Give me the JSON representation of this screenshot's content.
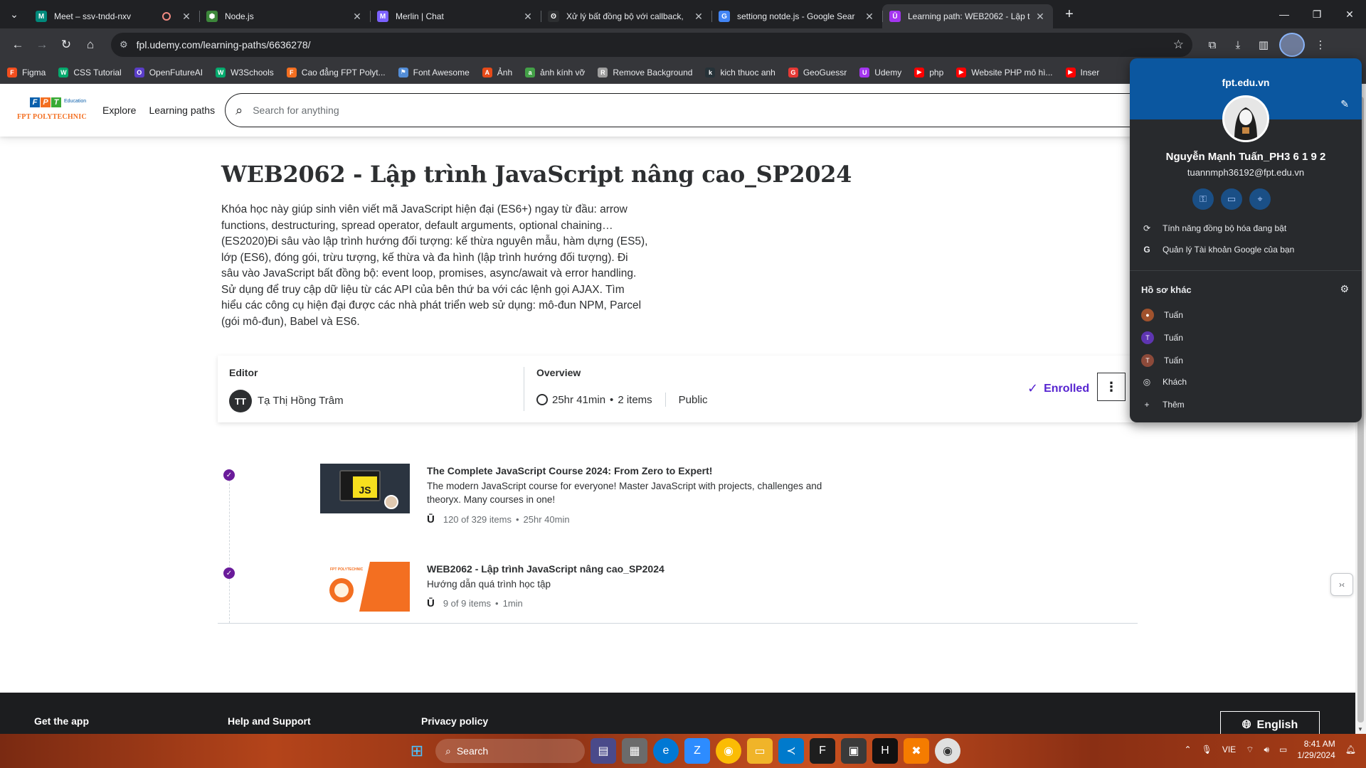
{
  "browser": {
    "tabs": [
      {
        "title": "Meet – ssv-tndd-nxv",
        "favicon_color": "#00897b",
        "favicon_glyph": "M",
        "recording": true
      },
      {
        "title": "Node.js",
        "favicon_color": "#3c873a",
        "favicon_glyph": "⬢",
        "recording": false
      },
      {
        "title": "Merlin | Chat",
        "favicon_color": "#7b61ff",
        "favicon_glyph": "M",
        "recording": false
      },
      {
        "title": "Xử lý bất đồng bộ với callback,",
        "favicon_color": "#2d2f31",
        "favicon_glyph": "ʘ",
        "recording": false
      },
      {
        "title": "settiong notde.js - Google Sear",
        "favicon_color": "#4285f4",
        "favicon_glyph": "G",
        "recording": false
      },
      {
        "title": "Learning path: WEB2062 - Lập t",
        "favicon_color": "#a435f0",
        "favicon_glyph": "Ū",
        "recording": false,
        "active": true
      }
    ],
    "url": "fpl.udemy.com/learning-paths/6636278/",
    "bookmarks": [
      {
        "label": "Figma",
        "color": "#f24e1e",
        "glyph": "F"
      },
      {
        "label": "CSS Tutorial",
        "color": "#04aa6d",
        "glyph": "W"
      },
      {
        "label": "OpenFutureAI",
        "color": "#5a3ec8",
        "glyph": "O"
      },
      {
        "label": "W3Schools",
        "color": "#04aa6d",
        "glyph": "W"
      },
      {
        "label": "Cao đẳng FPT Polyt...",
        "color": "#f36f21",
        "glyph": "F"
      },
      {
        "label": "Font Awesome",
        "color": "#538dd7",
        "glyph": "⚑"
      },
      {
        "label": "Ảnh",
        "color": "#e64a19",
        "glyph": "A"
      },
      {
        "label": "ảnh kính vỡ",
        "color": "#43a047",
        "glyph": "a"
      },
      {
        "label": "Remove Background",
        "color": "#9e9e9e",
        "glyph": "R"
      },
      {
        "label": "kich thuoc anh",
        "color": "#263238",
        "glyph": "k"
      },
      {
        "label": "GeoGuessr",
        "color": "#e53935",
        "glyph": "G"
      },
      {
        "label": "Udemy",
        "color": "#a435f0",
        "glyph": "U"
      },
      {
        "label": "php",
        "color": "#ff0000",
        "glyph": "▶"
      },
      {
        "label": "Website PHP mô hì...",
        "color": "#ff0000",
        "glyph": "▶"
      },
      {
        "label": "Inser",
        "color": "#ff0000",
        "glyph": "▶"
      }
    ]
  },
  "header": {
    "logo_brand": "FPT POLYTECHNIC",
    "logo_sub": "Education",
    "explore": "Explore",
    "learning_paths": "Learning paths",
    "search_placeholder": "Search for anything"
  },
  "path": {
    "title": "WEB2062 - Lập trình JavaScript nâng cao_SP2024",
    "description": "Khóa học này giúp sinh viên viết mã JavaScript hiện đại (ES6+) ngay từ đầu: arrow functions, destructuring, spread operator, default arguments, optional chaining…(ES2020)Đi sâu vào lập trình hướng đối tượng: kế thừa nguyên mẫu, hàm dựng (ES5), lớp (ES6), đóng gói, trừu tượng, kế thừa và đa hình (lập trình hướng đối tượng). Đi sâu vào JavaScript bất đồng bộ: event loop, promises, async/await và error handling. Sử dụng để truy cập dữ liệu từ các API của bên thứ ba với các lệnh gọi AJAX. Tìm hiểu các công cụ hiện đại được các nhà phát triển web sử dụng: mô-đun NPM, Parcel (gói mô-đun), Babel và ES6.",
    "editor_label": "Editor",
    "editor_initials": "TT",
    "editor_name": "Tạ Thị Hồng Trâm",
    "overview_label": "Overview",
    "duration": "25hr 41min",
    "items": "2 items",
    "visibility": "Public",
    "enrolled": "Enrolled"
  },
  "courses": [
    {
      "title": "The Complete JavaScript Course 2024: From Zero to Expert!",
      "subtitle": "The modern JavaScript course for everyone! Master JavaScript with projects, challenges and theoryx. Many courses in one!",
      "progress": "120 of 329 items",
      "duration": "25hr 40min",
      "thumb_text": "JS"
    },
    {
      "title": "WEB2062 - Lập trình JavaScript nâng cao_SP2024",
      "subtitle": "Hướng dẫn quá trình học tập",
      "progress": "9 of 9 items",
      "duration": "1min",
      "thumb_text": "FPT POLYTECHNIC"
    }
  ],
  "footer": {
    "get_app": "Get the app",
    "help": "Help and Support",
    "privacy": "Privacy policy",
    "language": "English"
  },
  "profile_popup": {
    "domain": "fpt.edu.vn",
    "name": "Nguyễn Mạnh Tuấn_PH3 6 1 9 2",
    "email": "tuannmph36192@fpt.edu.vn",
    "sync": "Tính năng đồng bộ hóa đang bật",
    "manage": "Quản lý Tài khoản Google của bạn",
    "other_profiles_label": "Hồ sơ khác",
    "profiles": [
      {
        "name": "Tuấn",
        "color": "#a0522d",
        "glyph": "●"
      },
      {
        "name": "Tuấn",
        "color": "#5e35b1",
        "glyph": "T"
      },
      {
        "name": "Tuấn",
        "color": "#8d4a3a",
        "glyph": "T"
      }
    ],
    "guest": "Khách",
    "add": "Thêm"
  },
  "taskbar": {
    "search": "Search",
    "lang": "VIE",
    "time": "8:41 AM",
    "date": "1/29/2024"
  }
}
